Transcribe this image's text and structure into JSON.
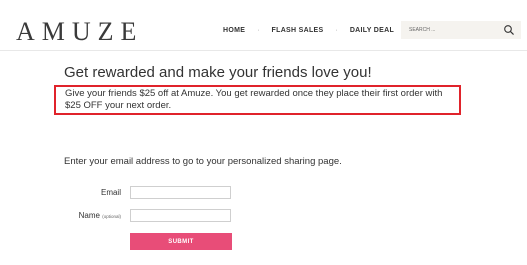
{
  "header": {
    "logo": "AMUZE",
    "nav": [
      {
        "label": "HOME"
      },
      {
        "label": "FLASH SALES"
      },
      {
        "label": "DAILY DEAL"
      }
    ],
    "separator": "·",
    "search": {
      "placeholder": "SEARCH ...",
      "value": ""
    }
  },
  "referral": {
    "headline": "Get rewarded and make your friends love you!",
    "description": "Give your friends $25 off at Amuze. You get rewarded once they place their first order with $25 OFF your next order.",
    "highlight_color": "#e0232b"
  },
  "form": {
    "prompt": "Enter your email address to go to your personalized sharing page.",
    "email_label": "Email",
    "email_value": "",
    "name_label": "Name",
    "name_sublabel": "(optional)",
    "name_value": "",
    "submit_label": "SUBMIT",
    "submit_color": "#e84d78"
  }
}
